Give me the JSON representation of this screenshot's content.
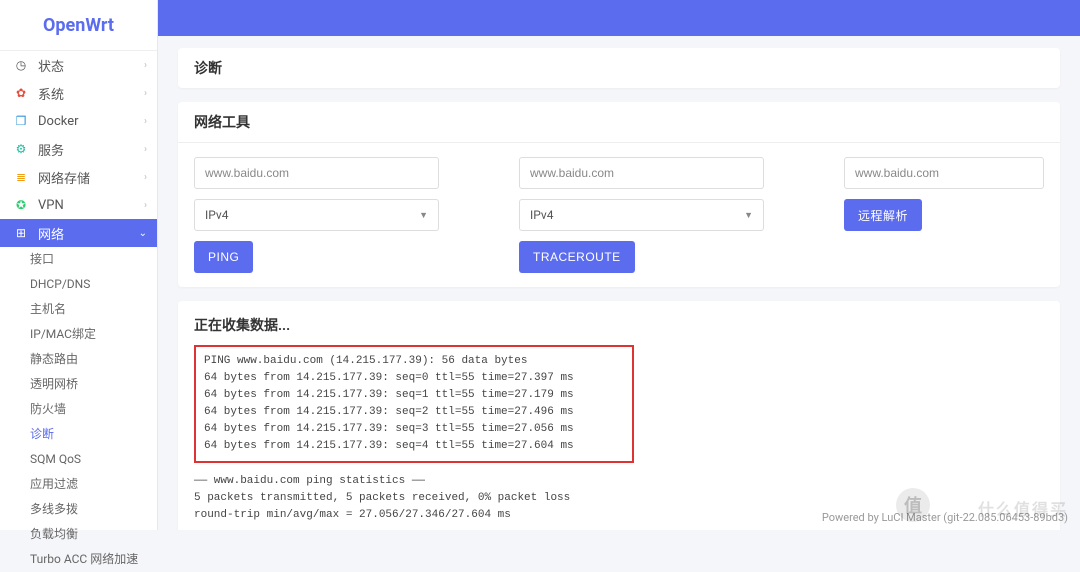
{
  "logo": "OpenWrt",
  "sidebar": {
    "items": [
      {
        "label": "状态",
        "icon": "◷",
        "iconClass": ""
      },
      {
        "label": "系统",
        "icon": "✿",
        "iconClass": "i-red"
      },
      {
        "label": "Docker",
        "icon": "❒",
        "iconClass": "i-blue"
      },
      {
        "label": "服务",
        "icon": "⚙",
        "iconClass": "i-teal"
      },
      {
        "label": "网络存储",
        "icon": "≣",
        "iconClass": "i-orange"
      },
      {
        "label": "VPN",
        "icon": "✪",
        "iconClass": "i-green"
      },
      {
        "label": "网络",
        "icon": "⊞",
        "iconClass": "",
        "active": true
      }
    ],
    "subitems": [
      "接口",
      "DHCP/DNS",
      "主机名",
      "IP/MAC绑定",
      "静态路由",
      "透明网桥",
      "防火墙",
      "诊断",
      "SQM QoS",
      "应用过滤",
      "多线多拨",
      "负载均衡",
      "Turbo ACC 网络加速"
    ],
    "currentSub": "诊断"
  },
  "page_title": "诊断",
  "tools_title": "网络工具",
  "tools": {
    "col1": {
      "host": "www.baidu.com",
      "proto": "IPv4",
      "button": "PING"
    },
    "col2": {
      "host": "www.baidu.com",
      "proto": "IPv4",
      "button": "TRACEROUTE"
    },
    "col3": {
      "host": "www.baidu.com",
      "button": "远程解析"
    }
  },
  "collecting": "正在收集数据...",
  "ping_output_boxed": "PING www.baidu.com (14.215.177.39): 56 data bytes\n64 bytes from 14.215.177.39: seq=0 ttl=55 time=27.397 ms\n64 bytes from 14.215.177.39: seq=1 ttl=55 time=27.179 ms\n64 bytes from 14.215.177.39: seq=2 ttl=55 time=27.496 ms\n64 bytes from 14.215.177.39: seq=3 ttl=55 time=27.056 ms\n64 bytes from 14.215.177.39: seq=4 ttl=55 time=27.604 ms",
  "ping_output_rest": "—— www.baidu.com ping statistics ——\n5 packets transmitted, 5 packets received, 0% packet loss\nround-trip min/avg/max = 27.056/27.346/27.604 ms",
  "footer": "Powered by LuCI Master (git-22.085.06453-89bd3)",
  "watermark": "什么值得买"
}
